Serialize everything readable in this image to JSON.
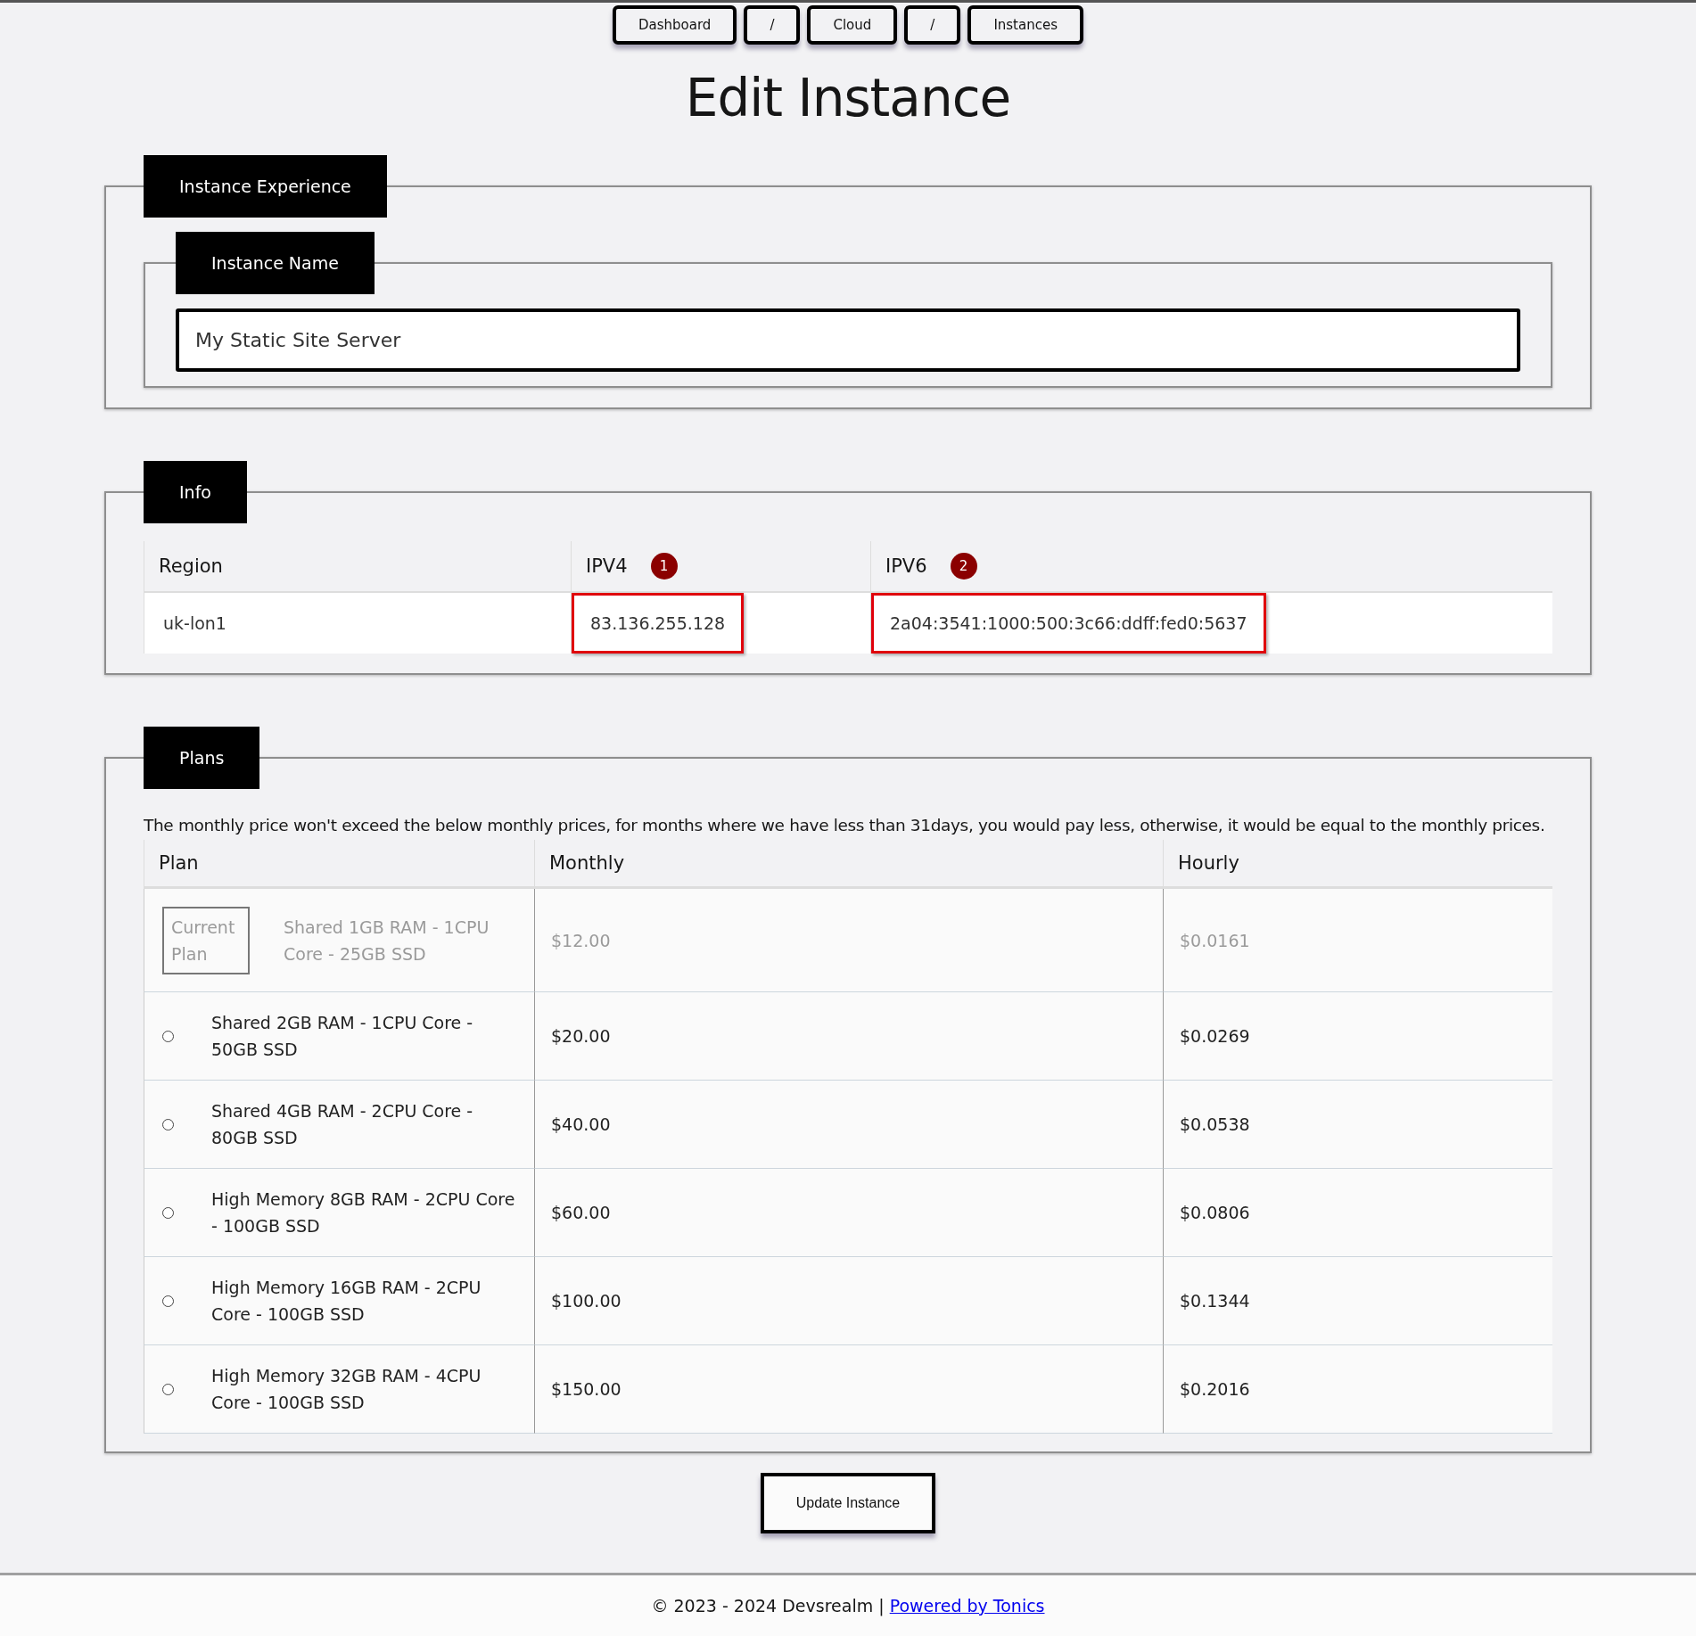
{
  "breadcrumbs": [
    "Dashboard",
    "/",
    "Cloud",
    "/",
    "Instances"
  ],
  "title": "Edit Instance",
  "instance_experience": {
    "legend": "Instance Experience",
    "name_field": {
      "legend": "Instance Name",
      "value": "My Static Site Server"
    }
  },
  "info": {
    "legend": "Info",
    "columns": [
      {
        "label": "Region"
      },
      {
        "label": "IPV4",
        "callout": "1"
      },
      {
        "label": "IPV6",
        "callout": "2"
      }
    ],
    "row": [
      {
        "value": "uk-lon1",
        "highlighted": false
      },
      {
        "value": "83.136.255.128",
        "highlighted": true
      },
      {
        "value": "2a04:3541:1000:500:3c66:ddff:fed0:5637",
        "highlighted": true
      }
    ]
  },
  "plans": {
    "legend": "Plans",
    "note": "The monthly price won't exceed the below monthly prices, for months where we have less than 31days, you would pay less, otherwise, it would be equal to the monthly prices.",
    "columns": [
      "Plan",
      "Monthly",
      "Hourly"
    ],
    "rows": [
      {
        "kind": "current",
        "badge": "Current Plan",
        "plan": "Shared 1GB RAM - 1CPU Core - 25GB SSD",
        "monthly": "$12.00",
        "hourly": "$0.0161"
      },
      {
        "kind": "option",
        "selected": false,
        "plan": "Shared 2GB RAM - 1CPU Core - 50GB SSD",
        "monthly": "$20.00",
        "hourly": "$0.0269"
      },
      {
        "kind": "option",
        "selected": false,
        "plan": "Shared 4GB RAM - 2CPU Core - 80GB SSD",
        "monthly": "$40.00",
        "hourly": "$0.0538"
      },
      {
        "kind": "option",
        "selected": false,
        "plan": "High Memory 8GB RAM - 2CPU Core - 100GB SSD",
        "monthly": "$60.00",
        "hourly": "$0.0806"
      },
      {
        "kind": "option",
        "selected": false,
        "plan": "High Memory 16GB RAM - 2CPU Core - 100GB SSD",
        "monthly": "$100.00",
        "hourly": "$0.1344"
      },
      {
        "kind": "option",
        "selected": false,
        "plan": "High Memory 32GB RAM - 4CPU Core - 100GB SSD",
        "monthly": "$150.00",
        "hourly": "$0.2016"
      }
    ]
  },
  "submit_button": "Update Instance",
  "footer": {
    "text": "© 2023 - 2024 Devsrealm |",
    "link": "Powered by Tonics"
  }
}
